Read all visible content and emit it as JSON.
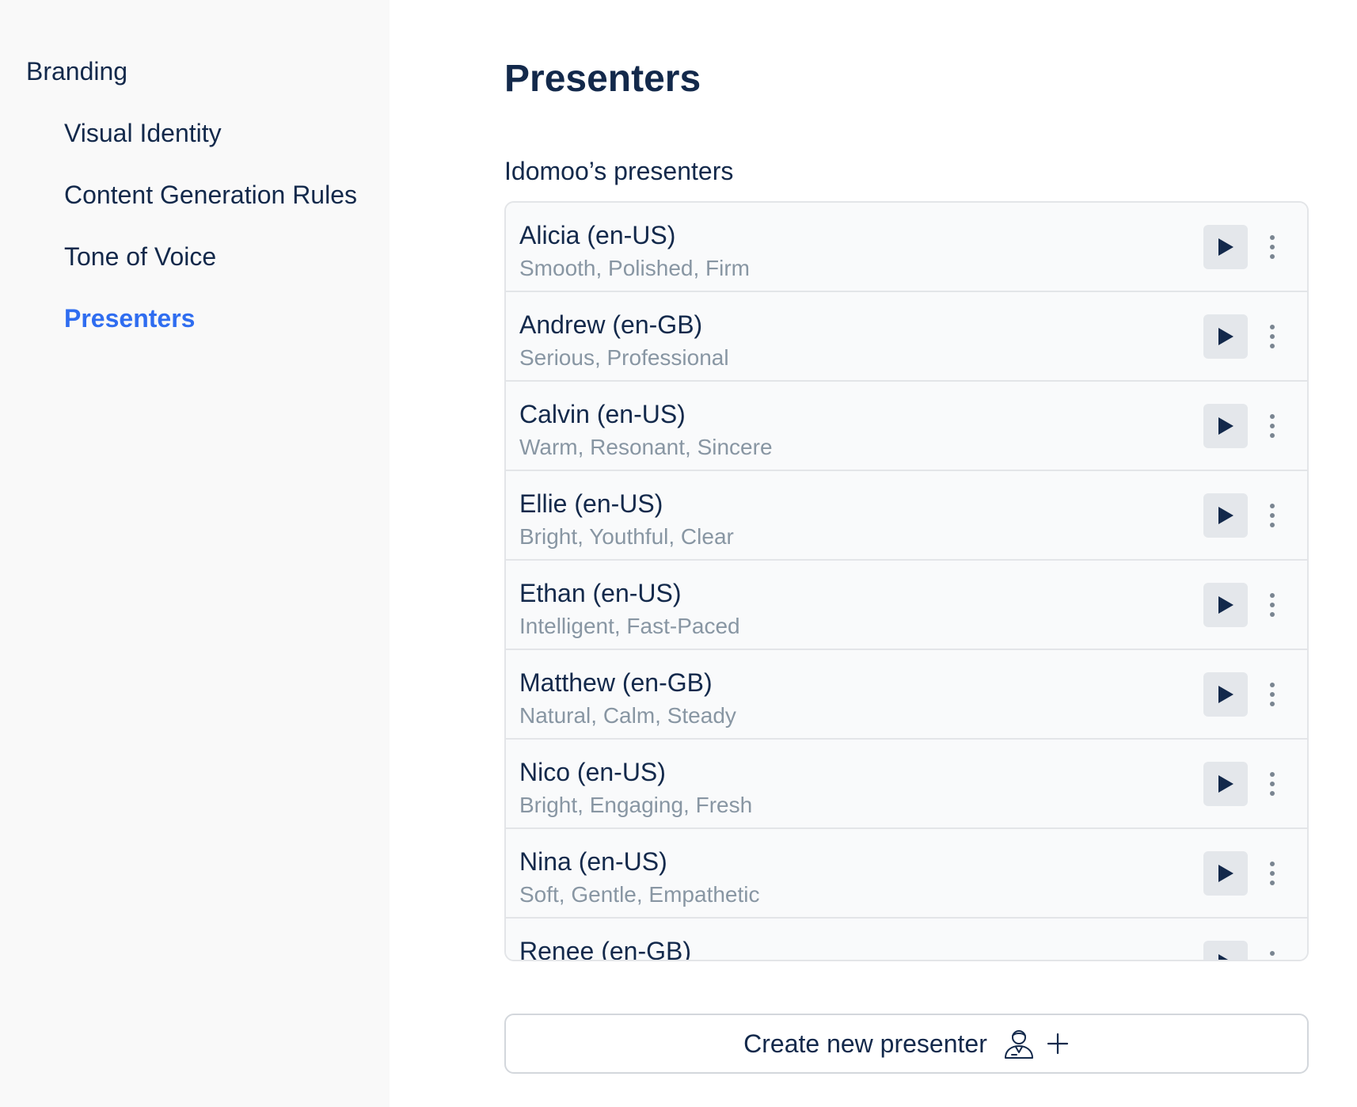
{
  "sidebar": {
    "section": "Branding",
    "items": [
      {
        "label": "Visual Identity",
        "active": false
      },
      {
        "label": "Content Generation Rules",
        "active": false
      },
      {
        "label": "Tone of Voice",
        "active": false
      },
      {
        "label": "Presenters",
        "active": true
      }
    ]
  },
  "main": {
    "title": "Presenters",
    "section_label": "Idomoo’s presenters",
    "presenters": [
      {
        "name": "Alicia (en-US)",
        "description": "Smooth, Polished, Firm"
      },
      {
        "name": "Andrew (en-GB)",
        "description": "Serious, Professional"
      },
      {
        "name": "Calvin (en-US)",
        "description": "Warm, Resonant, Sincere"
      },
      {
        "name": "Ellie (en-US)",
        "description": "Bright, Youthful, Clear"
      },
      {
        "name": "Ethan (en-US)",
        "description": "Intelligent, Fast-Paced"
      },
      {
        "name": "Matthew (en-GB)",
        "description": "Natural, Calm, Steady"
      },
      {
        "name": "Nico (en-US)",
        "description": "Bright, Engaging, Fresh"
      },
      {
        "name": "Nina (en-US)",
        "description": "Soft, Gentle, Empathetic"
      },
      {
        "name": "Renee (en-GB)",
        "description": ""
      }
    ],
    "create_button_label": "Create new presenter",
    "row_icons": {
      "play": "play-icon",
      "more": "more-vertical-icon"
    },
    "create_icons": [
      "presenter-icon",
      "plus-icon"
    ]
  },
  "colors": {
    "text": "#13294b",
    "active": "#2f6df0",
    "muted": "#8896a3",
    "sidebar_bg": "#f9f9f9",
    "border": "#e3e5e8"
  }
}
